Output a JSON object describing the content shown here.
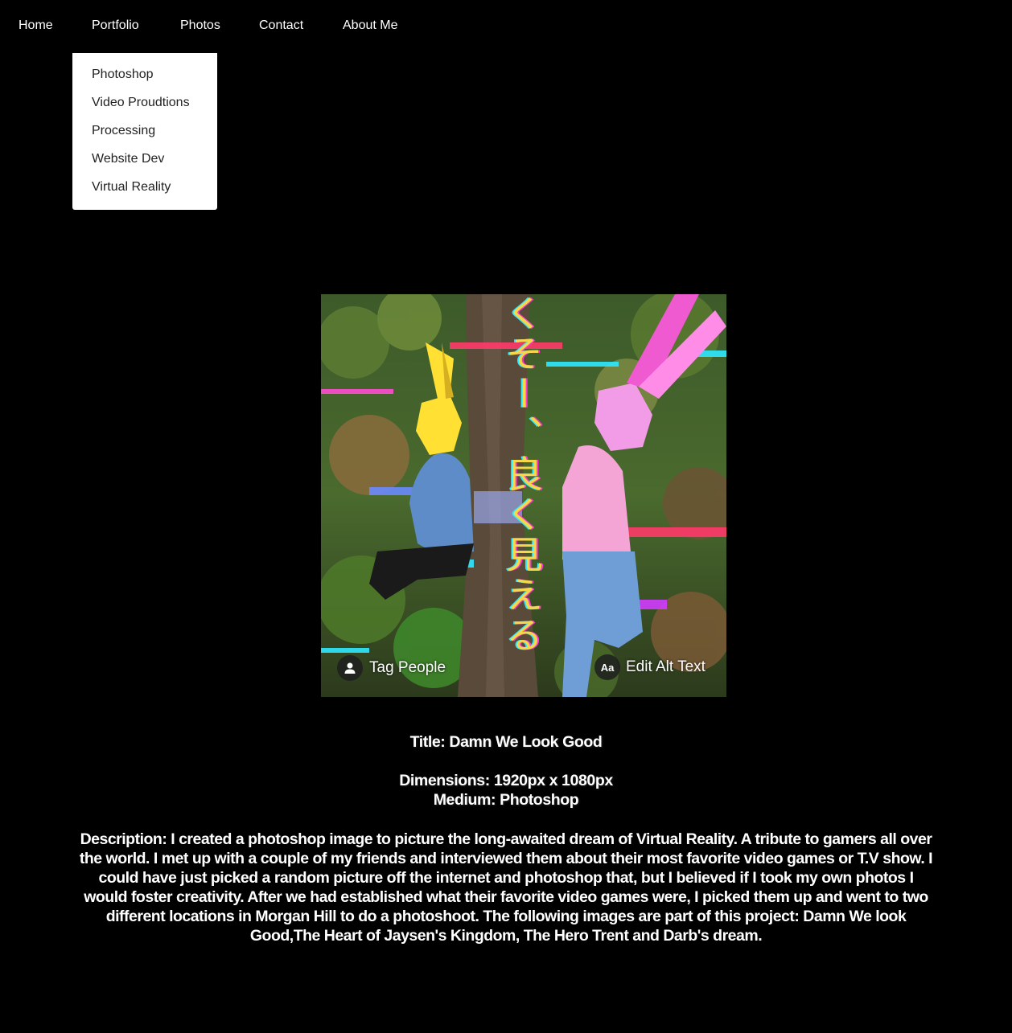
{
  "nav": {
    "items": [
      {
        "label": "Home"
      },
      {
        "label": "Portfolio"
      },
      {
        "label": "Photos"
      },
      {
        "label": "Contact"
      },
      {
        "label": "About Me"
      }
    ]
  },
  "dropdown": {
    "items": [
      {
        "label": "Photoshop"
      },
      {
        "label": "Video Proudtions"
      },
      {
        "label": "Processing"
      },
      {
        "label": "Website Dev"
      },
      {
        "label": "Virtual Reality"
      }
    ]
  },
  "photo": {
    "vertical_text": "くそー、良く見える",
    "tag_people_label": "Tag People",
    "alt_text_badge": "Aa",
    "edit_alt_text_label": "Edit Alt Text"
  },
  "details": {
    "title": "Title: Damn We Look Good",
    "dimensions": "Dimensions: 1920px x 1080px",
    "medium": "Medium: Photoshop",
    "description": "Description: I created a photoshop image to picture the long-awaited dream of Virtual Reality. A tribute to gamers all over the world. I met up with a couple of my friends and interviewed them about their most favorite video games or T.V show. I could have just picked a random picture off the internet and photoshop that, but I believed if I took my own photos I would foster creativity. After we had established what their favorite video games were, I picked them up and went to two different locations in Morgan Hill to do a photoshoot. The following images are part of this project: Damn We look Good,The Heart of Jaysen's Kingdom, The Hero Trent and Darb's dream."
  },
  "colors": {
    "background": "#000000",
    "dropdown_bg": "#ffffff",
    "vertical_text": "#f5d84a"
  }
}
